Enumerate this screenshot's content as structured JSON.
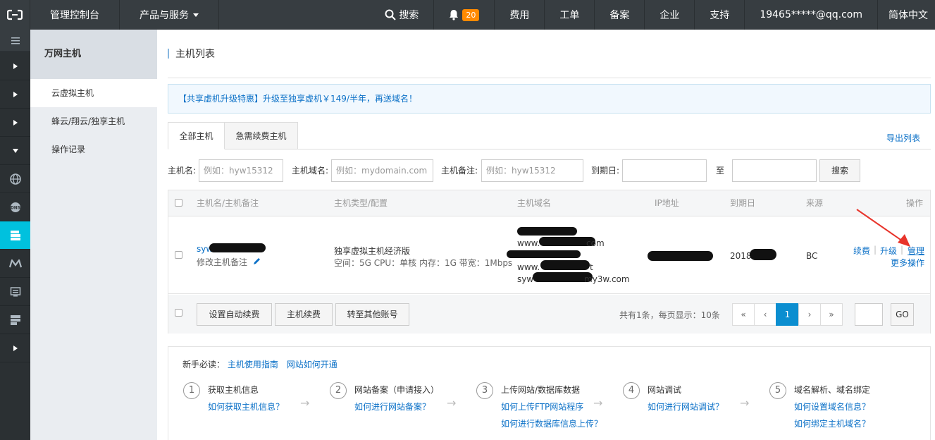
{
  "topbar": {
    "console": "管理控制台",
    "products": "产品与服务",
    "search": "搜索",
    "notify_count": "20",
    "links": [
      "费用",
      "工单",
      "备案",
      "企业",
      "支持"
    ],
    "account": "19465*****@qq.com",
    "language": "简体中文"
  },
  "sidebar": {
    "title": "万网主机",
    "items": [
      "云虚拟主机",
      "蜂云/翔云/独享主机",
      "操作记录"
    ]
  },
  "page": {
    "title": "主机列表",
    "promo": "【共享虚机升级特惠】升级至独享虚机￥149/半年，再送域名！",
    "tabs": [
      "全部主机",
      "急需续费主机"
    ],
    "export": "导出列表"
  },
  "filter": {
    "host_name_label": "主机名:",
    "host_name_placeholder": "例如：hyw15312",
    "domain_label": "主机域名:",
    "domain_placeholder": "例如：mydomain.com",
    "remark_label": "主机备注:",
    "remark_placeholder": "例如：hyw15312",
    "expire_label": "到期日:",
    "to_label": "至",
    "search_button": "搜索"
  },
  "table": {
    "headers": [
      "主机名/主机备注",
      "主机类型/配置",
      "主机域名",
      "IP地址",
      "到期日",
      "来源",
      "操作"
    ],
    "row": {
      "name_prefix": "syw",
      "edit_remark": "修改主机备注",
      "type": "独享虚拟主机经济版",
      "config": "空间：5G CPU：单核 内存：1G 带宽：1Mbps",
      "domain_1": "www.",
      "domain_1_tail": "com",
      "domain_2": "www.",
      "domain_2_tail": "t",
      "domain_3": "syw",
      "domain_3_tail": "my3w.com",
      "expire_prefix": "2018",
      "source": "BC",
      "actions": [
        "续费",
        "升级",
        "管理"
      ],
      "more_actions": "更多操作"
    },
    "footer": {
      "buttons": [
        "设置自动续费",
        "主机续费",
        "转至其他账号"
      ],
      "summary": "共有1条，每页显示：10条",
      "pager": [
        "«",
        "‹",
        "1",
        "›",
        "»"
      ],
      "go": "GO"
    }
  },
  "guide": {
    "header_label": "新手必读：",
    "header_links": [
      "主机使用指南",
      "网站如何开通"
    ],
    "steps": [
      {
        "num": "1",
        "title": "获取主机信息",
        "links": [
          "如何获取主机信息？"
        ]
      },
      {
        "num": "2",
        "title": "网站备案（申请接入）",
        "links": [
          "如何进行网站备案？"
        ]
      },
      {
        "num": "3",
        "title": "上传网站/数据库数据",
        "links": [
          "如何上传FTP网站程序",
          "如何进行数据库信息上传？"
        ]
      },
      {
        "num": "4",
        "title": "网站调试",
        "links": [
          "如何进行网站调试？"
        ]
      },
      {
        "num": "5",
        "title": "域名解析、域名绑定",
        "links": [
          "如何设置域名信息？",
          "如何绑定主机域名？"
        ]
      }
    ]
  },
  "colors": {
    "accent": "#00c1de",
    "link": "#0a70c7",
    "badge": "#ff8a00",
    "annotation_arrow": "#e8342b"
  }
}
